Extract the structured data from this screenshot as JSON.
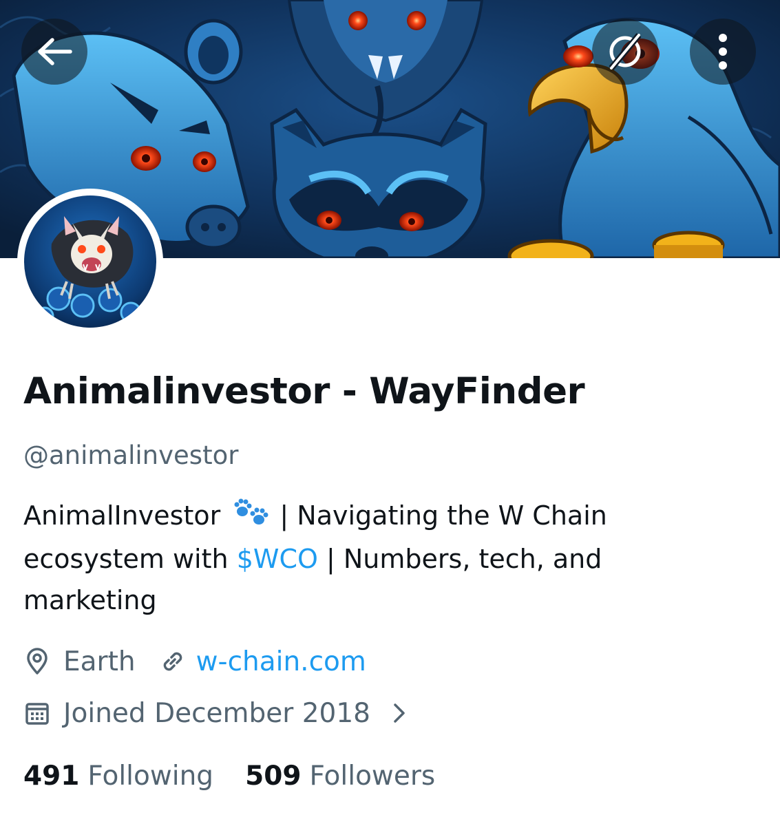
{
  "profile": {
    "display_name": "Animalinvestor - WayFinder",
    "handle": "@animalinvestor",
    "bio": {
      "line1_prefix": "AnimalInvestor",
      "line1_suffix": "| Navigating the W Chain",
      "line2_prefix": "ecosystem with",
      "line2_link": "$WCO",
      "line2_suffix": "| Numbers, tech, and",
      "line3": "marketing"
    },
    "location": "Earth",
    "website": "w-chain.com",
    "joined": "Joined December 2018",
    "following_count": "491",
    "following_label": "Following",
    "followers_count": "509",
    "followers_label": "Followers"
  },
  "icons": {
    "back": "back-arrow-icon",
    "grok": "grok-icon",
    "more": "more-vertical-icon",
    "location": "location-pin-icon",
    "link": "link-icon",
    "calendar": "calendar-icon",
    "chevron": "chevron-right-icon"
  },
  "colors": {
    "accent": "#1d9bf0",
    "text_primary": "#0f1419",
    "text_secondary": "#536471",
    "banner_dark": "#0b2340",
    "banner_mid": "#1e5d99",
    "banner_light": "#3fa3e6",
    "eye_red": "#ff3a1a",
    "coin_gold": "#f2b21a"
  }
}
